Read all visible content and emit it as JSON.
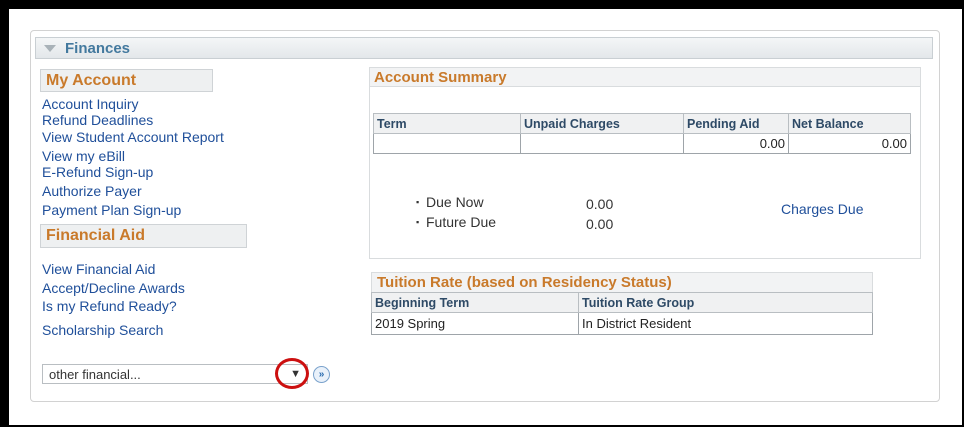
{
  "header": {
    "title": "Finances"
  },
  "my_account": {
    "title": "My Account",
    "links": [
      "Account Inquiry",
      "Refund Deadlines",
      "View Student Account Report",
      "View my eBill",
      "E-Refund Sign-up",
      "Authorize Payer",
      "Payment Plan Sign-up"
    ]
  },
  "financial_aid": {
    "title": "Financial Aid",
    "links": [
      "View Financial Aid",
      "Accept/Decline Awards",
      "Is my Refund Ready?",
      "Scholarship Search"
    ]
  },
  "dropdown": {
    "selected": "other financial...",
    "arrow": "▼",
    "go": "»"
  },
  "account_summary": {
    "title": "Account Summary",
    "columns": [
      "Term",
      "Unpaid Charges",
      "Pending Aid",
      "Net Balance"
    ],
    "row": [
      "",
      "",
      "0.00",
      "0.00"
    ],
    "due_now_label": "Due Now",
    "due_now_value": "0.00",
    "future_due_label": "Future Due",
    "future_due_value": "0.00",
    "charges_due_link": "Charges Due"
  },
  "tuition_rate": {
    "title": "Tuition Rate (based on Residency Status)",
    "columns": [
      "Beginning Term",
      "Tuition Rate Group"
    ],
    "row": [
      "2019 Spring",
      "In District Resident"
    ]
  }
}
